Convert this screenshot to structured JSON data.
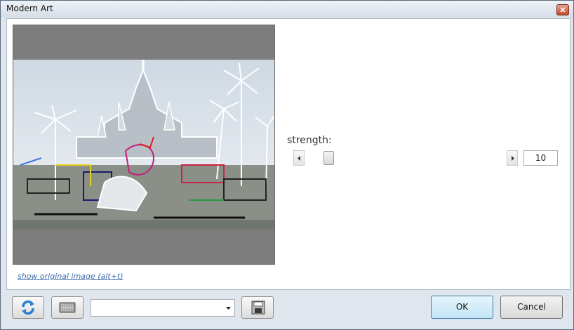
{
  "window": {
    "title": "Modern Art"
  },
  "preview": {
    "alt": "filtered photo preview",
    "show_original_label": "show original image (alt+t)"
  },
  "strength": {
    "label": "strength:",
    "value": "10",
    "slider_fraction": 0.1
  },
  "footer": {
    "combo_value": "",
    "ok_label": "OK",
    "cancel_label": "Cancel"
  },
  "icons": {
    "close": "close-icon",
    "refresh": "refresh-icon",
    "keyboard": "keyboard-icon",
    "save": "save-icon",
    "scroll_left": "chevron-left-icon",
    "scroll_right": "chevron-right-icon",
    "dropdown": "chevron-down-icon"
  },
  "colors": {
    "accent": "#3c7fb1",
    "link": "#3a6aa8"
  }
}
